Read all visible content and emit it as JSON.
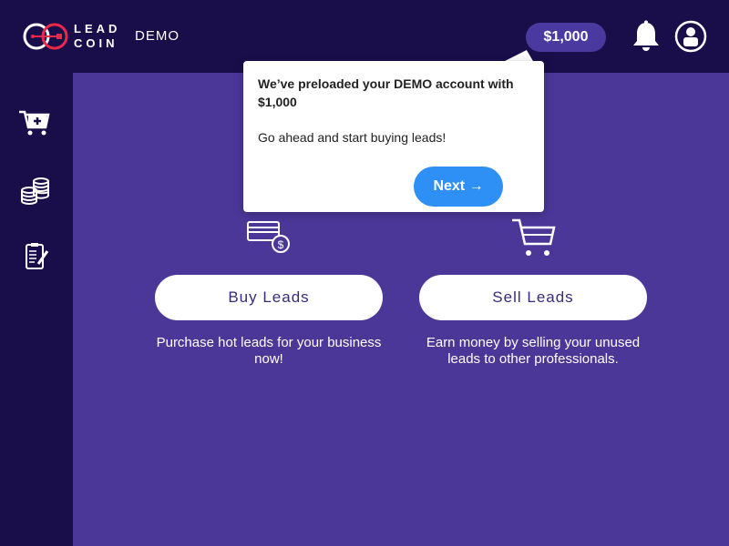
{
  "header": {
    "logo_line1": "LEAD",
    "logo_line2": "COIN",
    "mode_label": "DEMO",
    "balance": "$1,000"
  },
  "icons": {
    "cart_add": "cart-add-icon",
    "coins": "coins-icon",
    "clipboard": "clipboard-icon",
    "bell": "bell-icon",
    "profile": "profile-icon"
  },
  "actions": {
    "buy": {
      "label": "Buy Leads",
      "description": "Purchase hot leads for your business now!"
    },
    "sell": {
      "label": "Sell Leads",
      "description": "Earn money by selling your unused leads to other professionals."
    }
  },
  "tooltip": {
    "title": "We’ve preloaded your DEMO account with $1,000",
    "body": "Go ahead and start buying leads!",
    "next_label": "Next →"
  },
  "colors": {
    "nav_bg": "#1a0e4a",
    "main_bg": "#4a3798",
    "accent": "#2e8ff5",
    "logo_red": "#e8294b"
  }
}
